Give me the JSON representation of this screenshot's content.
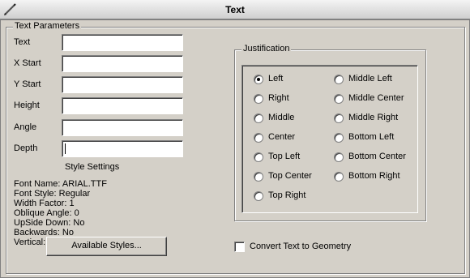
{
  "window": {
    "title": "Text"
  },
  "text_parameters": {
    "legend": "Text Parameters",
    "fields": [
      {
        "label": "Text",
        "value": ""
      },
      {
        "label": "X Start",
        "value": ""
      },
      {
        "label": "Y Start",
        "value": ""
      },
      {
        "label": "Height",
        "value": ""
      },
      {
        "label": "Angle",
        "value": ""
      },
      {
        "label": "Depth",
        "value": ""
      }
    ],
    "style_settings_label": "Style Settings",
    "style_lines": [
      "Font Name: ARIAL.TTF",
      "Font Style: Regular",
      "Width Factor: 1",
      "Oblique Angle: 0",
      "UpSide Down: No",
      "Backwards: No",
      "Vertical: No"
    ],
    "available_styles_button": "Available Styles..."
  },
  "justification": {
    "legend": "Justification",
    "options": [
      {
        "label": "Left",
        "checked": true
      },
      {
        "label": "Right",
        "checked": false
      },
      {
        "label": "Middle",
        "checked": false
      },
      {
        "label": "Center",
        "checked": false
      },
      {
        "label": "Top Left",
        "checked": false
      },
      {
        "label": "Top Center",
        "checked": false
      },
      {
        "label": "Top Right",
        "checked": false
      },
      {
        "label": "Middle Left",
        "checked": false
      },
      {
        "label": "Middle Center",
        "checked": false
      },
      {
        "label": "Middle Right",
        "checked": false
      },
      {
        "label": "Bottom Left",
        "checked": false
      },
      {
        "label": "Bottom Center",
        "checked": false
      },
      {
        "label": "Bottom Right",
        "checked": false
      }
    ]
  },
  "convert": {
    "label": "Convert Text to Geometry",
    "checked": false
  },
  "icons": {
    "title": "pencil-icon"
  }
}
